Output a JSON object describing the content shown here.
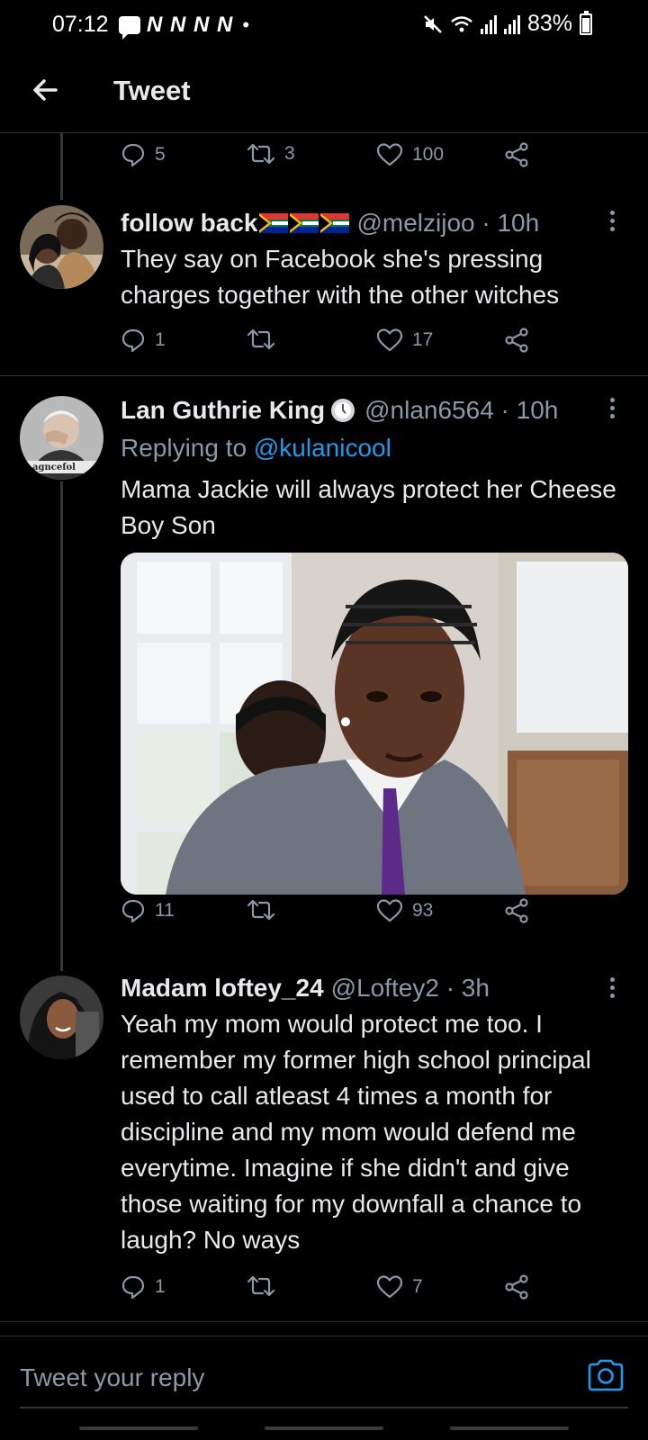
{
  "status_bar": {
    "time": "07:12",
    "notif_letters": "N N N N",
    "dot": "•",
    "battery": "83%"
  },
  "header": {
    "title": "Tweet"
  },
  "top_actions": {
    "replies": "5",
    "retweets": "3",
    "likes": "100"
  },
  "tweets": [
    {
      "name": "follow back",
      "handle": "@melzijoo · 10h",
      "text": "They say on Facebook she's pressing charges together with the other witches",
      "replies": "1",
      "retweets": "",
      "likes": "17"
    },
    {
      "name": "Lan Guthrie King",
      "handle": "@nlan6564 · 10h",
      "replying_prefix": "Replying to",
      "replying_to": "@kulanicool",
      "text": "Mama Jackie will always protect her Cheese Boy Son",
      "replies": "11",
      "retweets": "",
      "likes": "93",
      "avatar_text": "agncefol"
    },
    {
      "name": "Madam loftey_24",
      "handle": "@Loftey2 · 3h",
      "text": "Yeah my mom would protect me too. I remember my former high school principal used to call atleast 4 times a month for discipline and my mom would defend me everytime. Imagine if she didn't and give those waiting for my downfall a chance to laugh? No ways",
      "replies": "1",
      "retweets": "",
      "likes": "7"
    }
  ],
  "reply_bar": {
    "placeholder": "Tweet your reply"
  },
  "colors": {
    "accent": "#1d9bf0",
    "muted": "#8b98a5",
    "background": "#000000"
  }
}
